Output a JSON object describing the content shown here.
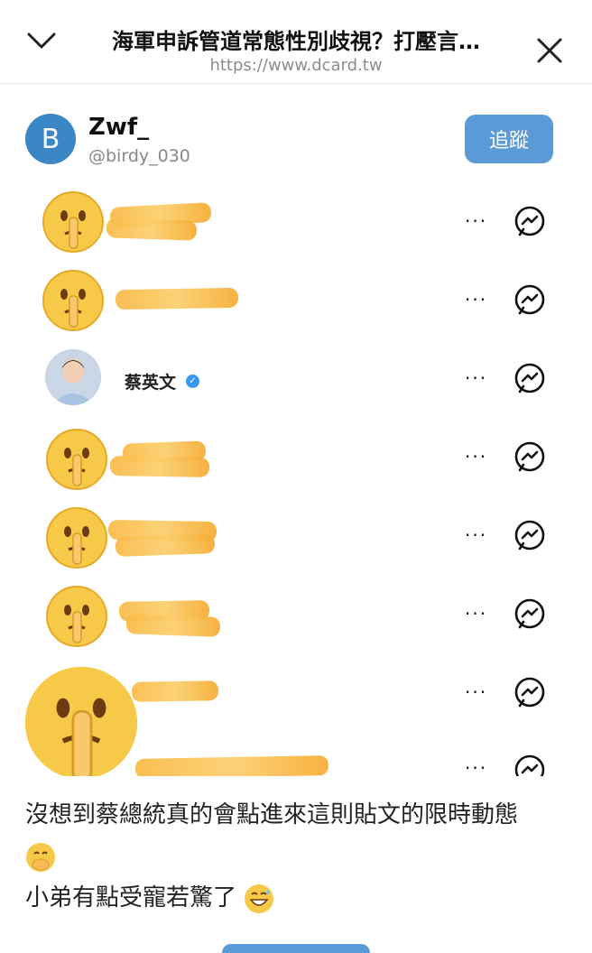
{
  "header": {
    "title": "海軍申訴管道常態性別歧視？打壓言…",
    "url": "https://www.dcard.tw"
  },
  "profile": {
    "avatar_letter": "B",
    "name": "Zwf_",
    "handle": "@birdy_030",
    "follow_label": "追蹤"
  },
  "viewers": [
    {
      "type": "hidden"
    },
    {
      "type": "hidden"
    },
    {
      "type": "named",
      "name": "蔡英文",
      "verified": true
    },
    {
      "type": "hidden"
    },
    {
      "type": "hidden"
    },
    {
      "type": "hidden"
    },
    {
      "type": "hidden"
    },
    {
      "type": "hidden"
    }
  ],
  "row_actions": {
    "more": "···"
  },
  "caption": {
    "line1": "沒想到蔡總統真的會點進來這則貼文的限時動態",
    "line2": "小弟有點受寵若驚了"
  },
  "colors": {
    "accent": "#5b9bd8",
    "avatar": "#3b86c4",
    "redact": "#f9b944"
  }
}
